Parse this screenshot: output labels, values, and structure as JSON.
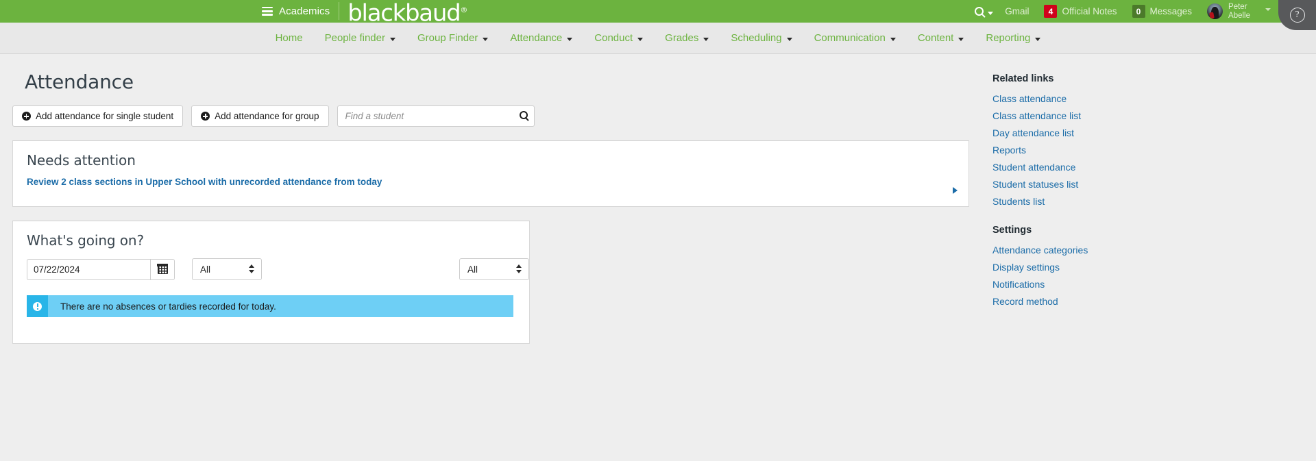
{
  "topbar": {
    "hamburger_icon": "hamburger-menu-icon",
    "academics_label": "Academics",
    "brand": "blackbaud",
    "brand_reg": "®",
    "search_icon": "search-icon",
    "gmail_label": "Gmail",
    "official_notes": {
      "count": "4",
      "label": "Official Notes"
    },
    "messages": {
      "count": "0",
      "label": "Messages"
    },
    "user": {
      "first_name": "Peter",
      "last_name": "Abelle",
      "avatar_icon": "user-avatar"
    },
    "help_icon": "question-mark-icon",
    "colors": {
      "green": "#6cb33f",
      "badge_red": "#d0021b",
      "badge_dark": "#4b7a2a",
      "help_gray": "#58595b"
    }
  },
  "nav": {
    "items": [
      {
        "label": "Home",
        "has_caret": false
      },
      {
        "label": "People finder",
        "has_caret": true
      },
      {
        "label": "Group Finder",
        "has_caret": true
      },
      {
        "label": "Attendance",
        "has_caret": true
      },
      {
        "label": "Conduct",
        "has_caret": true
      },
      {
        "label": "Grades",
        "has_caret": true
      },
      {
        "label": "Scheduling",
        "has_caret": true
      },
      {
        "label": "Communication",
        "has_caret": true
      },
      {
        "label": "Content",
        "has_caret": true
      },
      {
        "label": "Reporting",
        "has_caret": true
      }
    ]
  },
  "page": {
    "title": "Attendance",
    "actions": {
      "add_single_label": "Add attendance for single student",
      "add_group_label": "Add attendance for group",
      "plus_icon": "plus-circle-icon",
      "search_placeholder": "Find a student",
      "search_value": "",
      "search_icon": "search-icon"
    },
    "needs_attention": {
      "title": "Needs attention",
      "link": "Review 2 class sections in Upper School with unrecorded attendance from today",
      "arrow_icon": "chevron-right-icon"
    },
    "whats_going_on": {
      "title": "What's going on?",
      "date_value": "07/22/2024",
      "calendar_icon": "calendar-icon",
      "filter_one": "All",
      "filter_two": "All",
      "alert": {
        "icon": "info-exclamation-icon",
        "text": "There are no absences or tardies recorded for today."
      }
    }
  },
  "sidebar": {
    "related_links_head": "Related links",
    "related_links": [
      {
        "label": "Class attendance"
      },
      {
        "label": "Class attendance list"
      },
      {
        "label": "Day attendance list"
      },
      {
        "label": "Reports"
      },
      {
        "label": "Student attendance"
      },
      {
        "label": "Student statuses list"
      },
      {
        "label": "Students list"
      }
    ],
    "settings_head": "Settings",
    "settings_links": [
      {
        "label": "Attendance categories"
      },
      {
        "label": "Display settings"
      },
      {
        "label": "Notifications"
      },
      {
        "label": "Record method"
      }
    ]
  }
}
